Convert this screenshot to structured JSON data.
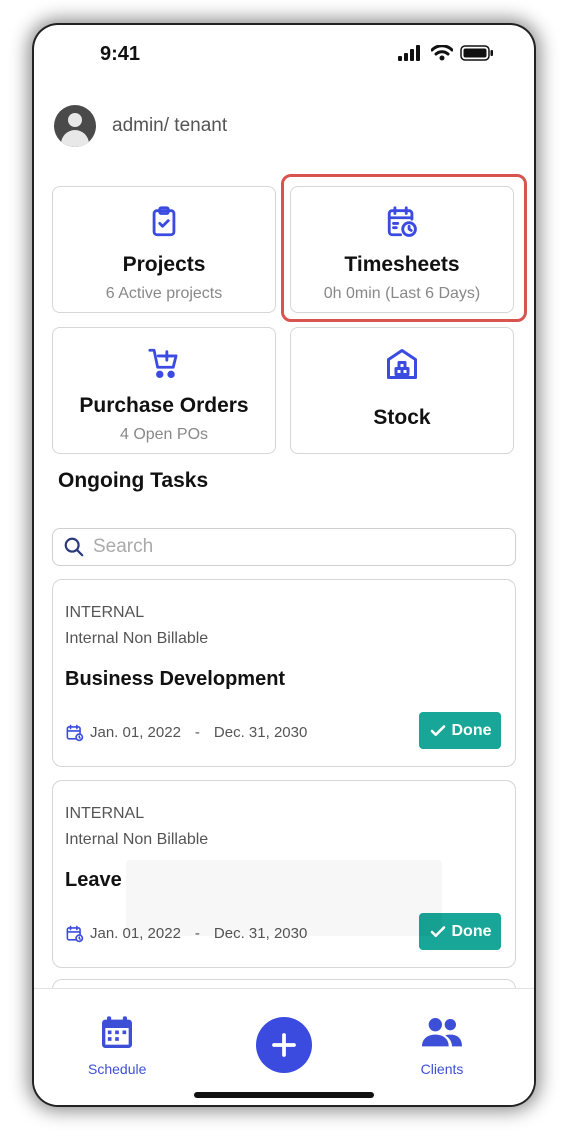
{
  "status_bar": {
    "time": "9:41"
  },
  "user": {
    "label": "admin/ tenant"
  },
  "cards": {
    "projects": {
      "title": "Projects",
      "subtitle": "6   Active projects",
      "icon": "clipboard-check-icon"
    },
    "timesheets": {
      "title": "Timesheets",
      "subtitle": "0h 0min  (Last 6 Days)",
      "icon": "calendar-clock-icon"
    },
    "purchase_orders": {
      "title": "Purchase Orders",
      "subtitle": "4  Open POs",
      "icon": "cart-plus-icon"
    },
    "stock": {
      "title": "Stock",
      "icon": "warehouse-icon"
    }
  },
  "ongoing": {
    "title": "Ongoing Tasks"
  },
  "search": {
    "placeholder": "Search"
  },
  "tasks": [
    {
      "type": "INTERNAL",
      "billing": "Internal Non Billable",
      "name": "Business Development",
      "start": "Jan. 01, 2022",
      "sep": "-",
      "end": "Dec. 31, 2030",
      "status": "Done"
    },
    {
      "type": "INTERNAL",
      "billing": "Internal Non Billable",
      "name": "Leave",
      "start": "Jan. 01, 2022",
      "sep": "-",
      "end": "Dec. 31, 2030",
      "status": "Done"
    }
  ],
  "bottom_nav": {
    "schedule": "Schedule",
    "clients": "Clients"
  },
  "colors": {
    "accent": "#3b4be0",
    "done": "#17a697",
    "highlight": "#d9534f"
  }
}
